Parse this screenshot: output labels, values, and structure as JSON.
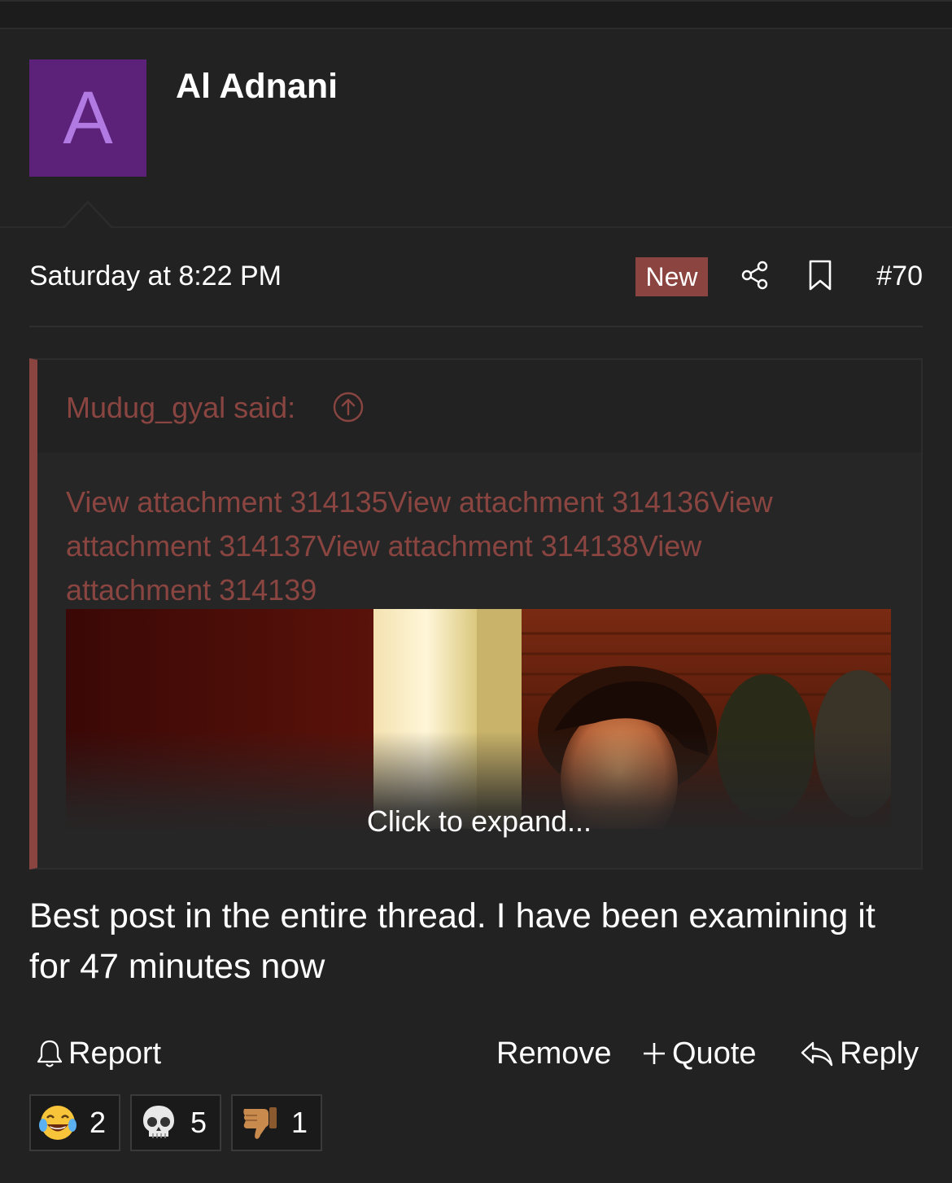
{
  "user": {
    "avatar_letter": "A",
    "name": "Al Adnani",
    "avatar_color": "#5c2179"
  },
  "post": {
    "date": "Saturday at 8:22 PM",
    "new_badge": "New",
    "number": "#70",
    "body": "Best post in the entire thread. I have been examining it for 47 minutes now"
  },
  "quote": {
    "author": "Mudug_gyal said:",
    "links_text": "View attachment 314135View attachment 314136View attachment 314137View attachment 314138View attachment 314139",
    "expand_label": "Click to expand..."
  },
  "actions": {
    "report": "Report",
    "remove": "Remove",
    "quote": "Quote",
    "reply": "Reply"
  },
  "reactions": [
    {
      "icon": "laughing-crying-emoji-icon",
      "count": "2"
    },
    {
      "icon": "skull-emoji-icon",
      "count": "5"
    },
    {
      "icon": "thumbs-down-emoji-icon",
      "count": "1"
    }
  ],
  "colors": {
    "background": "#222223",
    "accent": "#8a4541",
    "new_badge": "#8c4440"
  }
}
